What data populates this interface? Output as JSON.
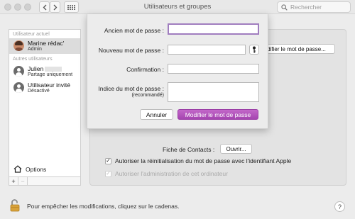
{
  "window": {
    "title": "Utilisateurs et groupes"
  },
  "search": {
    "placeholder": "Rechercher"
  },
  "sidebar": {
    "current_label": "Utilisateur actuel",
    "others_label": "Autres utilisateurs",
    "users": [
      {
        "name": "Marine rédac'",
        "role": "Admin"
      },
      {
        "name": "Julien",
        "role": "Partage uniquement"
      },
      {
        "name": "Utilisateur invité",
        "role": "Désactivé"
      }
    ],
    "options_label": "Options",
    "add_label": "+",
    "remove_label": "−"
  },
  "main": {
    "change_password_label": "Modifier le mot de passe...",
    "contacts_label": "Fiche de Contacts :",
    "open_label": "Ouvrir...",
    "allow_reset_label": "Autoriser la réinitialisation du mot de passe avec l'identifiant Apple",
    "allow_admin_label": "Autoriser l'administration de cet ordinateur"
  },
  "footer": {
    "lock_text": "Pour empêcher les modifications, cliquez sur le cadenas.",
    "help_label": "?"
  },
  "sheet": {
    "old_password_label": "Ancien mot de passe :",
    "new_password_label": "Nouveau mot de passe :",
    "confirm_label": "Confirmation :",
    "hint_label": "Indice du mot de passe :",
    "hint_sub": "(recommandé)",
    "cancel_label": "Annuler",
    "submit_label": "Modifier le mot de passe"
  },
  "colors": {
    "accent": "#b153bb",
    "focus_ring": "#a07dbf"
  }
}
